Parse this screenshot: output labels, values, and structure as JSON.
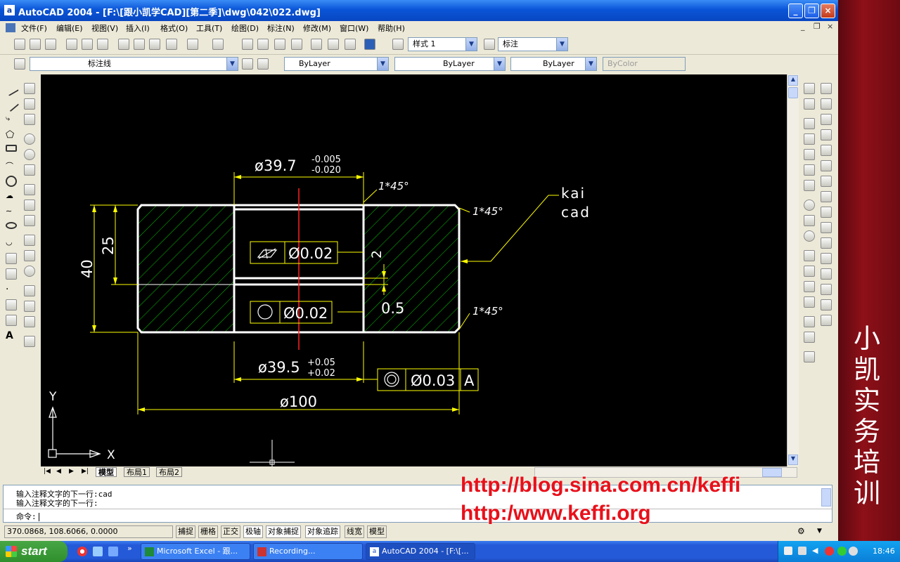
{
  "window": {
    "title": "AutoCAD 2004 - [F:\\[跟小凯学CAD][第二季]\\dwg\\042\\022.dwg]",
    "app_icon": "a"
  },
  "menus": [
    "文件(F)",
    "编辑(E)",
    "视图(V)",
    "插入(I)",
    "格式(O)",
    "工具(T)",
    "绘图(D)",
    "标注(N)",
    "修改(M)",
    "窗口(W)",
    "帮助(H)"
  ],
  "mdi": {
    "min": "_",
    "restore": "❐",
    "close": "×"
  },
  "toolbars": {
    "text_style": "样式 1",
    "dim_style": "标注",
    "layer": "标注线",
    "color": "ByLayer",
    "linetype": "ByLayer",
    "lineweight": "ByLayer",
    "plotstyle": "ByColor"
  },
  "drawing": {
    "dim_top": "ø39.7",
    "tol_top_upper": "-0.005",
    "tol_top_lower": "-0.020",
    "chamfer1": "1*45°",
    "chamfer2": "1*45°",
    "chamfer3": "1*45°",
    "leader_text1": "kai",
    "leader_text2": "cad",
    "dim_25": "25",
    "dim_40": "40",
    "dim_2": "2",
    "dim_05": "0.5",
    "fcf_flat_val": "Ø0.02",
    "fcf_circ_val": "Ø0.02",
    "fcf_conc_val": "Ø0.03",
    "fcf_conc_datum": "A",
    "dim_bottom": "ø39.5",
    "tol_bot_upper": "+0.05",
    "tol_bot_lower": "+0.02",
    "dim_100": "ø100",
    "ucs_y": "Y",
    "ucs_x": "X"
  },
  "colors": {
    "canvas": "#000000",
    "geometry": "#ffffff",
    "dimension": "#ffff00",
    "hatch": "#00cc00",
    "centerline": "#ff2020"
  },
  "layout_tabs": [
    "模型",
    "布局1",
    "布局2"
  ],
  "command": {
    "line1": "输入注释文字的下一行:cad",
    "line2": "输入注释文字的下一行:",
    "prompt": "命令:"
  },
  "status": {
    "coords": "370.0868, 108.6066, 0.0000",
    "buttons": [
      "捕捉",
      "栅格",
      "正交",
      "极轴",
      "对象捕捉",
      "对象追踪",
      "线宽",
      "模型"
    ]
  },
  "watermark": {
    "brand": "小凯实务培训",
    "url1": "http://blog.sina.com.cn/keffi",
    "url2": "http:/www.keffi.org"
  },
  "taskbar": {
    "start": "start",
    "tasks": [
      "Microsoft Excel - 跟...",
      "Recording...",
      "AutoCAD 2004 - [F:\\[..."
    ],
    "clock": "18:46"
  }
}
